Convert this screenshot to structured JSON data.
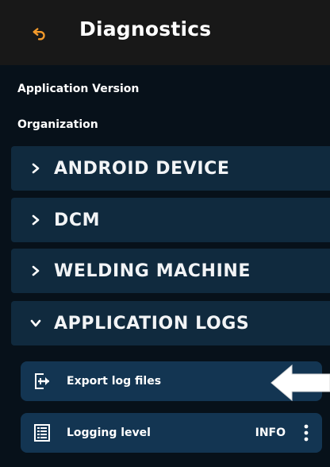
{
  "header": {
    "title": "Diagnostics",
    "back_icon": "undo-arrow-icon",
    "accent_color": "#f39a2b"
  },
  "info": {
    "application_version_label": "Application Version",
    "organization_label": "Organization"
  },
  "sections": [
    {
      "label": "ANDROID DEVICE",
      "expanded": false
    },
    {
      "label": "DCM",
      "expanded": false
    },
    {
      "label": "WELDING MACHINE",
      "expanded": false
    },
    {
      "label": "APPLICATION LOGS",
      "expanded": true
    }
  ],
  "application_logs": {
    "export": {
      "label": "Export log files",
      "icon": "export-icon"
    },
    "logging_level": {
      "label": "Logging level",
      "value": "INFO",
      "icon": "list-icon",
      "menu_icon": "more-vert-icon"
    }
  },
  "colors": {
    "section_bg": "#102a3e",
    "item_bg": "#133552",
    "header_bg": "#181818"
  }
}
